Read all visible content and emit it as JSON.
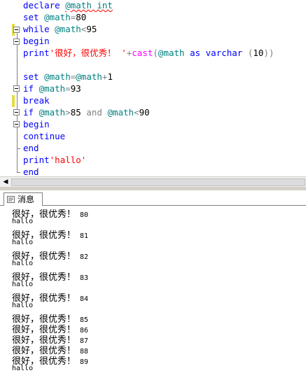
{
  "editor": {
    "lines": [
      {
        "id": "l1",
        "tokens": [
          [
            "kw",
            "declare "
          ],
          [
            "var squiggle",
            "@math int"
          ]
        ]
      },
      {
        "id": "l2",
        "tokens": [
          [
            "kw",
            "set "
          ],
          [
            "var",
            "@math"
          ],
          [
            "op",
            "="
          ],
          [
            "num",
            "80"
          ]
        ]
      },
      {
        "id": "l3",
        "tokens": [
          [
            "kw",
            "while "
          ],
          [
            "var",
            "@math"
          ],
          [
            "op",
            "<"
          ],
          [
            "num",
            "95"
          ]
        ]
      },
      {
        "id": "l4",
        "tokens": [
          [
            "kw",
            "begin"
          ]
        ]
      },
      {
        "id": "l5",
        "tokens": [
          [
            "kw",
            "print"
          ],
          [
            "str",
            "'"
          ],
          [
            "str cjk",
            "很好，很优秀！"
          ],
          [
            "str",
            " '"
          ],
          [
            "op",
            "+"
          ],
          [
            "fn",
            "cast"
          ],
          [
            "op",
            "("
          ],
          [
            "var",
            "@math "
          ],
          [
            "kw",
            "as varchar "
          ],
          [
            "op",
            "("
          ],
          [
            "num",
            "10"
          ],
          [
            "op",
            "))"
          ]
        ]
      },
      {
        "id": "l6",
        "tokens": []
      },
      {
        "id": "l7",
        "tokens": [
          [
            "kw",
            "set "
          ],
          [
            "var",
            "@math"
          ],
          [
            "op",
            "="
          ],
          [
            "var",
            "@math"
          ],
          [
            "op",
            "+"
          ],
          [
            "num",
            "1"
          ]
        ]
      },
      {
        "id": "l8",
        "tokens": [
          [
            "kw",
            "if "
          ],
          [
            "var",
            "@math"
          ],
          [
            "op",
            "="
          ],
          [
            "num",
            "93"
          ]
        ]
      },
      {
        "id": "l9",
        "tokens": [
          [
            "kw",
            "break"
          ]
        ]
      },
      {
        "id": "l10",
        "tokens": [
          [
            "kw",
            "if "
          ],
          [
            "var",
            "@math"
          ],
          [
            "op",
            ">"
          ],
          [
            "num",
            "85 "
          ],
          [
            "op",
            "and "
          ],
          [
            "var",
            "@math"
          ],
          [
            "op",
            "<"
          ],
          [
            "num",
            "90"
          ]
        ]
      },
      {
        "id": "l11",
        "tokens": [
          [
            "kw",
            "begin"
          ]
        ]
      },
      {
        "id": "l12",
        "tokens": [
          [
            "kw",
            "continue"
          ]
        ]
      },
      {
        "id": "l13",
        "tokens": [
          [
            "kw",
            "end"
          ]
        ]
      },
      {
        "id": "l14",
        "tokens": [
          [
            "kw",
            "print"
          ],
          [
            "str",
            "'hallo'"
          ]
        ]
      },
      {
        "id": "l15",
        "tokens": [
          [
            "kw",
            "end"
          ]
        ]
      }
    ]
  },
  "results": {
    "tab_label": "消息",
    "messages": [
      {
        "type": "line",
        "text": "很好，很优秀！",
        "num": "80"
      },
      {
        "type": "hallo",
        "text": "hallo"
      },
      {
        "type": "line",
        "text": "很好，很优秀！",
        "num": "81"
      },
      {
        "type": "hallo",
        "text": "hallo"
      },
      {
        "type": "line",
        "text": "很好，很优秀！",
        "num": "82"
      },
      {
        "type": "hallo",
        "text": "hallo"
      },
      {
        "type": "line",
        "text": "很好，很优秀！",
        "num": "83"
      },
      {
        "type": "hallo",
        "text": "hallo"
      },
      {
        "type": "line",
        "text": "很好，很优秀！",
        "num": "84"
      },
      {
        "type": "hallo",
        "text": "hallo"
      },
      {
        "type": "line",
        "text": "很好，很优秀！",
        "num": "85"
      },
      {
        "type": "line",
        "text": "很好，很优秀！",
        "num": "86"
      },
      {
        "type": "line",
        "text": "很好，很优秀！",
        "num": "87"
      },
      {
        "type": "line",
        "text": "很好，很优秀！",
        "num": "88"
      },
      {
        "type": "line",
        "text": "很好，很优秀！",
        "num": "89"
      },
      {
        "type": "hallo",
        "text": "hallo"
      }
    ]
  },
  "icons": {
    "scroll_left": "scroll-left-arrow",
    "messages_tab": "messages-icon",
    "fold": "fold-toggle"
  }
}
